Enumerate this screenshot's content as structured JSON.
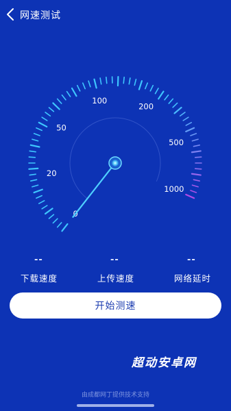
{
  "header": {
    "title": "网速测试",
    "back_icon": "chevron-left-icon"
  },
  "gauge": {
    "labels": [
      "0",
      "20",
      "50",
      "100",
      "200",
      "500",
      "1000"
    ],
    "current_value": 0,
    "colors": {
      "ticks": "#3ec6ff",
      "high_end": "#b14be6",
      "needle": "#4fd0ff"
    }
  },
  "stats": [
    {
      "value": "--",
      "label": "下载速度"
    },
    {
      "value": "--",
      "label": "上传速度"
    },
    {
      "value": "--",
      "label": "网络延时"
    }
  ],
  "start_button": {
    "label": "开始测速"
  },
  "watermark": "超动安卓网",
  "footer": "由成都网丁提供技术支持"
}
